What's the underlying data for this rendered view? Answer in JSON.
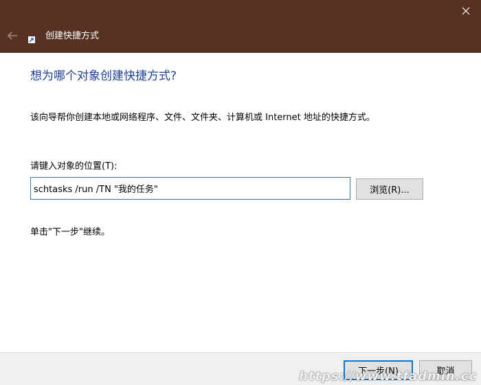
{
  "window": {
    "title": "创建快捷方式",
    "titlebar_color": "#573223",
    "back_icon": "back-arrow-icon",
    "close_icon": "close-icon"
  },
  "main": {
    "heading": "想为哪个对象创建快捷方式?",
    "heading_color": "#1a3fa0",
    "description": "该向导帮你创建本地或网络程序、文件、文件夹、计算机或 Internet 地址的快捷方式。",
    "location_label": "请键入对象的位置(T):",
    "location_value": "schtasks /run /TN \"我的任务\"",
    "browse_label": "浏览(R)...",
    "hint": "单击\"下一步\"继续。"
  },
  "footer": {
    "next_label": "下一步(N)",
    "cancel_label": "取消",
    "watermark": "https://www.tfadmin.cc"
  }
}
